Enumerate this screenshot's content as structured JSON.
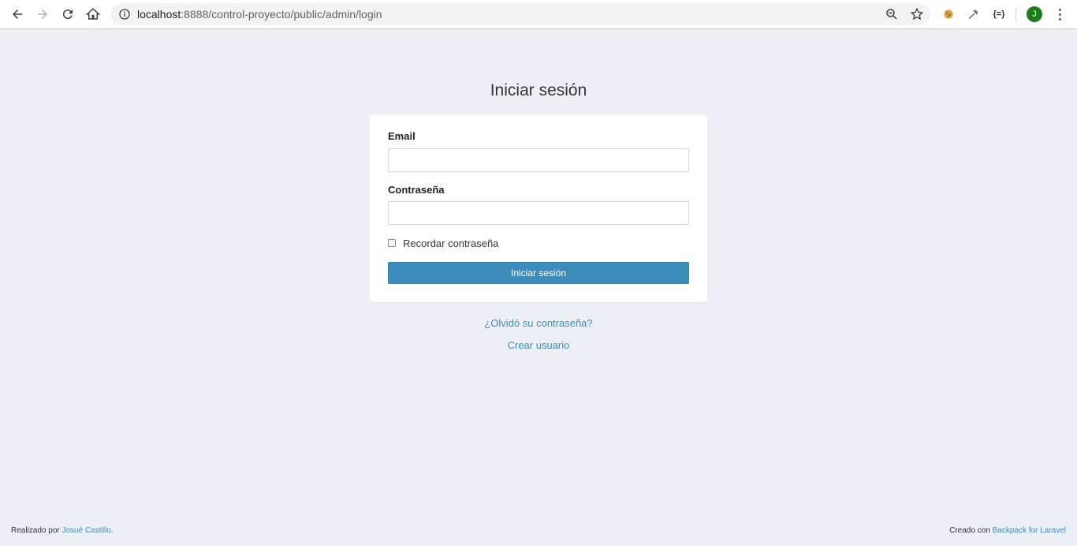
{
  "browser": {
    "url_host": "localhost",
    "url_rest": ":8888/control-proyecto/public/admin/login",
    "avatar_letter": "J",
    "ext_json_label": "{=}"
  },
  "login": {
    "title": "Iniciar sesión",
    "email_label": "Email",
    "email_value": "",
    "password_label": "Contraseña",
    "password_value": "",
    "remember_label": "Recordar contraseña",
    "remember_checked": false,
    "submit_label": "Iniciar sesión",
    "forgot_link": "¿Olvidó su contraseña?",
    "register_link": "Crear usuario"
  },
  "footer": {
    "left_prefix": "Realizado por",
    "left_link": "Josué Castillo",
    "left_suffix": ".",
    "right_prefix": "Creado con",
    "right_link": "Backpack for Laravel"
  },
  "colors": {
    "background": "#ecf0f5",
    "primary": "#3c8dbc",
    "avatar": "#1e7b1e"
  }
}
